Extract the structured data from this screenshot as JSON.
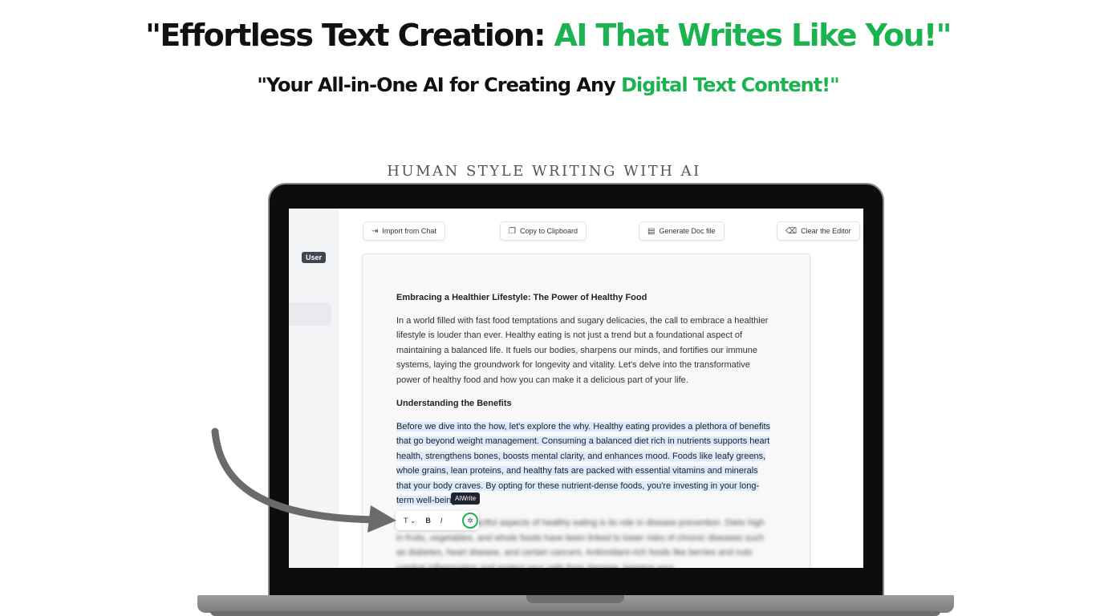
{
  "hero": {
    "headline_part1": "\"Effortless Text Creation: ",
    "headline_part2": "AI That Writes Like You!\"",
    "subheadline_part1": "\"Your All-in-One AI for Creating Any ",
    "subheadline_part2": "Digital Text Content!\"",
    "tagline": "HUMAN STYLE WRITING WITH AI"
  },
  "colors": {
    "accent": "#1bb34f",
    "highlight": "#dbeafe",
    "badge": "#3f4650"
  },
  "sidebar": {
    "user_badge": "User"
  },
  "toolbar": {
    "import_label": "Import from Chat",
    "copy_label": "Copy to Clipboard",
    "generate_label": "Generate Doc file",
    "clear_label": "Clear the Editor"
  },
  "document": {
    "title": "Embracing a Healthier Lifestyle: The Power of Healthy Food",
    "para1": "In a world filled with fast food temptations and sugary delicacies, the call to embrace a healthier lifestyle is louder than ever. Healthy eating is not just a trend but a foundational aspect of maintaining a balanced life. It fuels our bodies, sharpens our minds, and fortifies our immune systems, laying the groundwork for longevity and vitality. Let's delve into the transformative power of healthy food and how you can make it a delicious part of your life.",
    "section_heading": "Understanding the Benefits",
    "para2": "Before we dive into the how, let's explore the why. Healthy eating provides a plethora of benefits that go beyond weight management. Consuming a balanced diet rich in nutrients supports heart health, strengthens bones, boosts mental clarity, and enhances mood. Foods like leafy greens, whole grains, lean proteins, and healthy fats are packed with essential vitamins and minerals that your body craves. By opting for these nutrient-dense foods, you're investing in your long-term well-being.",
    "para3": "One of the most impactful aspects of healthy eating is its role in disease prevention. Diets high in fruits, vegetables, and whole foods have been linked to lower risks of chronic diseases such as diabetes, heart disease, and certain cancers. Antioxidant-rich foods like berries and nuts combat inflammation and protect your cells from damage, keeping your"
  },
  "floating_toolbar": {
    "text_style": "T",
    "bold": "B",
    "italic": "I",
    "ai_icon": "sparkle-icon",
    "tooltip": "AIWrite"
  }
}
